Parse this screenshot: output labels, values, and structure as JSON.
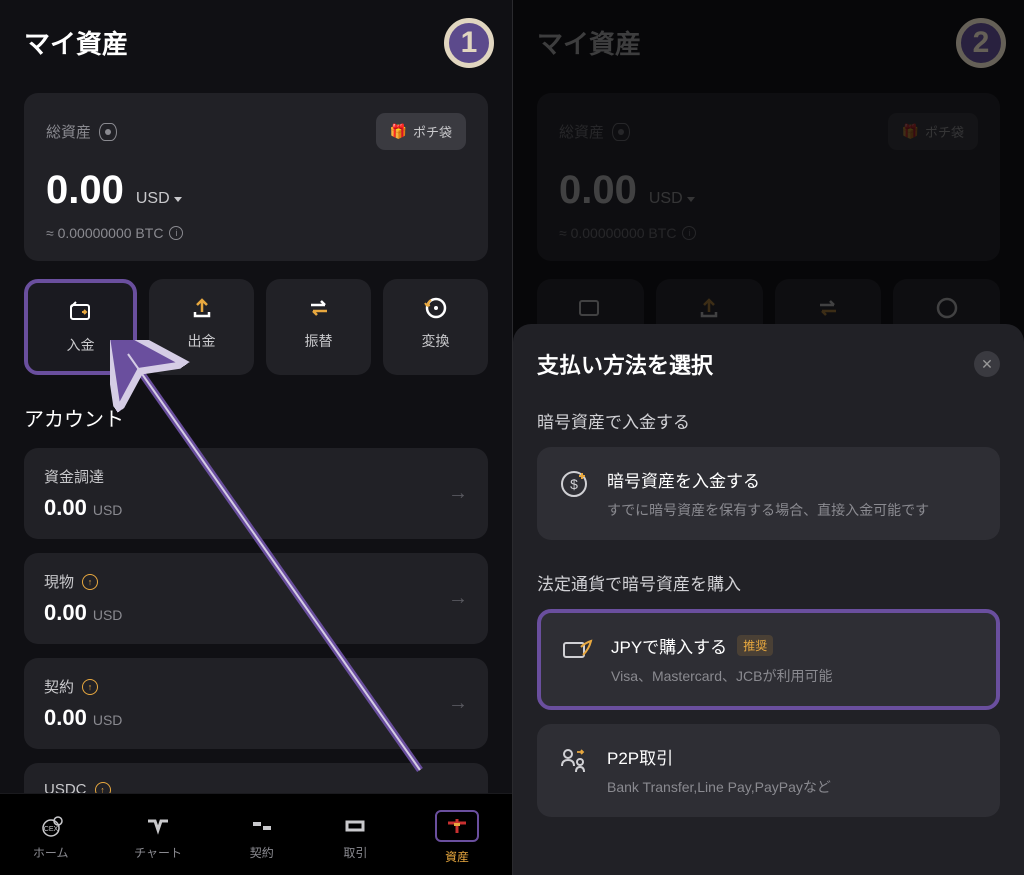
{
  "left": {
    "header": "マイ資産",
    "badge": "1",
    "asset": {
      "label": "総資産",
      "bonusBtn": "ポチ袋",
      "amount": "0.00",
      "currency": "USD",
      "btcEquiv": "≈ 0.00000000 BTC"
    },
    "actions": {
      "deposit": "入金",
      "withdraw": "出金",
      "transfer": "振替",
      "convert": "変換"
    },
    "accountOverview": "アカウント",
    "accounts": {
      "funding": {
        "name": "資金調達",
        "amount": "0.00",
        "curr": "USD"
      },
      "spot": {
        "name": "現物",
        "amount": "0.00",
        "curr": "USD"
      },
      "contract": {
        "name": "契約",
        "amount": "0.00",
        "curr": "USD"
      },
      "usdc": {
        "name": "USDC",
        "amount": "",
        "curr": ""
      }
    },
    "nav": {
      "home": "ホーム",
      "chart": "チャート",
      "contract": "契約",
      "trade": "取引",
      "assets": "資産"
    }
  },
  "right": {
    "header": "マイ資産",
    "badge": "2",
    "asset": {
      "label": "総資産",
      "bonusBtn": "ポチ袋",
      "amount": "0.00",
      "currency": "USD",
      "btcEquiv": "≈ 0.00000000 BTC"
    },
    "sheet": {
      "title": "支払い方法を選択",
      "section1": "暗号資産で入金する",
      "cryptoDeposit": {
        "title": "暗号資産を入金する",
        "desc": "すでに暗号資産を保有する場合、直接入金可能です"
      },
      "section2": "法定通貨で暗号資産を購入",
      "buyJpy": {
        "title": "JPYで購入する",
        "badge": "推奨",
        "desc": "Visa、Mastercard、JCBが利用可能"
      },
      "p2p": {
        "title": "P2P取引",
        "desc": "Bank Transfer,Line Pay,PayPayなど"
      }
    }
  }
}
